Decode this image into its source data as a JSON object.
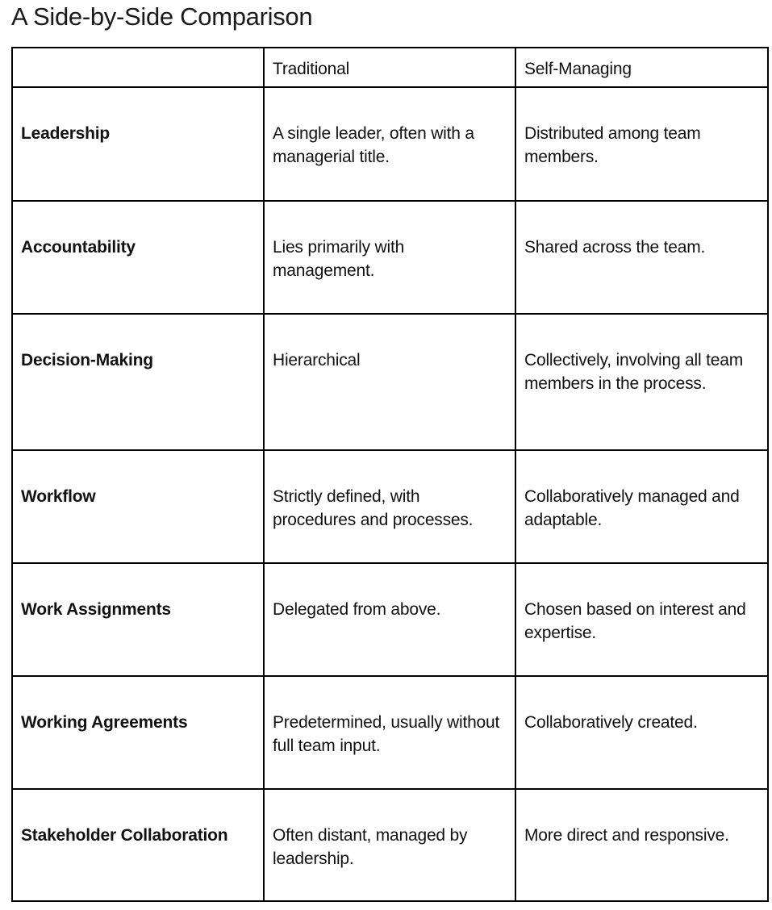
{
  "title": "A Side-by-Side Comparison",
  "table": {
    "headers": [
      "",
      "Traditional",
      "Self-Managing"
    ],
    "rows": [
      {
        "label": "Leadership",
        "traditional": "A single leader, often with a managerial title.",
        "self_managing": "Distributed among team members."
      },
      {
        "label": "Accountability",
        "traditional": "Lies primarily with management.",
        "self_managing": "Shared across the team."
      },
      {
        "label": "Decision-Making",
        "traditional": "Hierarchical",
        "self_managing": "Collectively, involving all team members in the process."
      },
      {
        "label": "Workflow",
        "traditional": "Strictly defined, with procedures and processes.",
        "self_managing": "Collaboratively managed and adaptable."
      },
      {
        "label": "Work Assignments",
        "traditional": "Delegated from above.",
        "self_managing": "Chosen based on interest and expertise."
      },
      {
        "label": "Working Agreements",
        "traditional": "Predetermined, usually without full team input.",
        "self_managing": "Collaboratively created."
      },
      {
        "label": "Stakeholder Collaboration",
        "traditional": "Often distant, managed by leadership.",
        "self_managing": "More direct and responsive."
      }
    ]
  }
}
